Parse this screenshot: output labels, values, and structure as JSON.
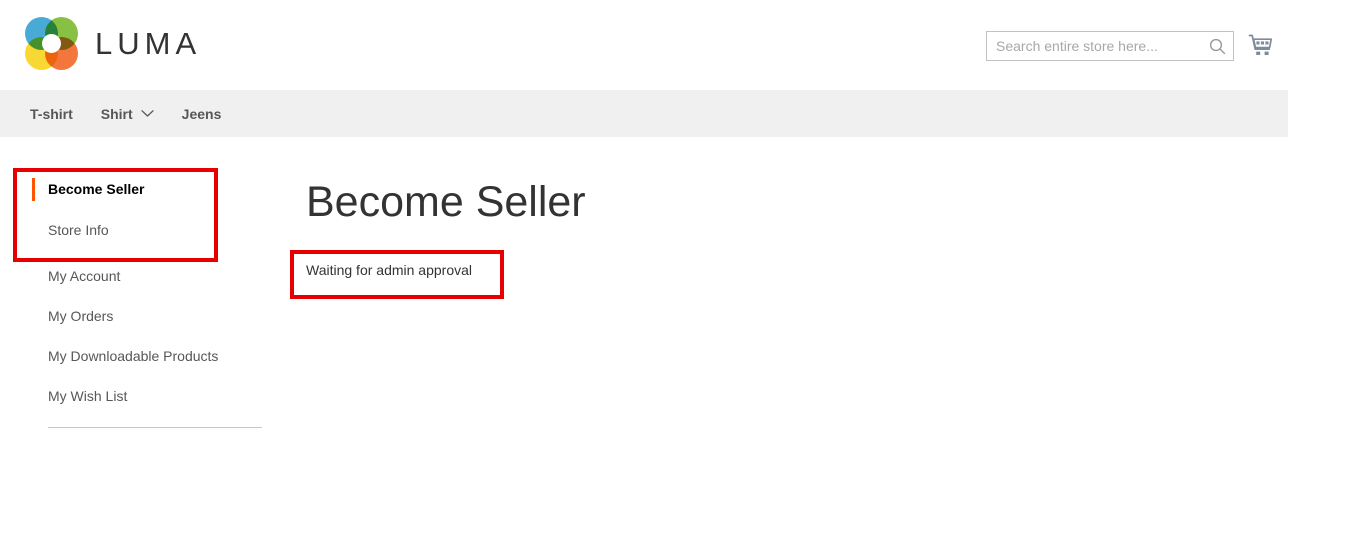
{
  "header": {
    "logo_text": "LUMA",
    "logo_icon": "luma-rings-logo",
    "logo_colors": {
      "blue": "#2f9fd0",
      "green": "#77b82a",
      "yellow": "#f7d417",
      "orange": "#f26322"
    },
    "search": {
      "placeholder": "Search entire store here...",
      "value": "",
      "icon": "search-icon"
    },
    "cart": {
      "icon": "shopping-cart-icon",
      "count": ""
    }
  },
  "nav": {
    "items": [
      {
        "label": "T-shirt",
        "has_caret": false
      },
      {
        "label": "Shirt",
        "has_caret": true,
        "caret_icon": "chevron-down-icon"
      },
      {
        "label": "Jeens",
        "has_caret": false
      }
    ]
  },
  "sidebar": {
    "seller_group": [
      {
        "label": "Become Seller",
        "current": true
      },
      {
        "label": "Store Info",
        "current": false
      }
    ],
    "account_group": [
      {
        "label": "My Account",
        "current": false
      },
      {
        "label": "My Orders",
        "current": false
      },
      {
        "label": "My Downloadable Products",
        "current": false
      },
      {
        "label": "My Wish List",
        "current": false
      }
    ]
  },
  "main": {
    "title": "Become Seller",
    "message": "Waiting for admin approval"
  },
  "annotations": {
    "color": "#e60000",
    "boxes": [
      {
        "name": "seller-menu-highlight"
      },
      {
        "name": "approval-message-highlight"
      }
    ]
  }
}
